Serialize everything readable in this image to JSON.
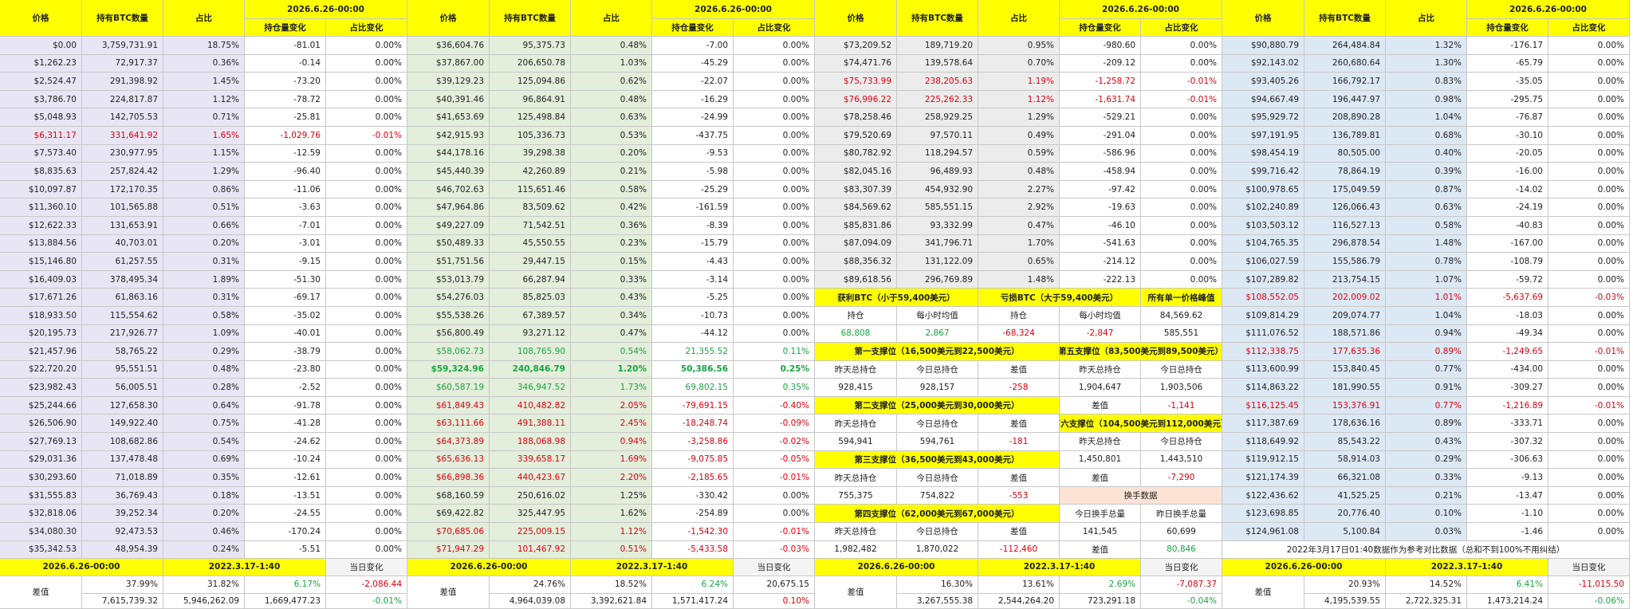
{
  "colors": {
    "block_bg": [
      "#e8e6f4",
      "#e3eedb",
      "#ececec",
      "#dde8f5"
    ],
    "header": "#ffff00",
    "red": "#e0000e",
    "green": "#1aa541",
    "swap": "#fbe3d6",
    "footer": "#f4f4f4"
  },
  "header": {
    "price": "价格",
    "btc": "持有BTC数量",
    "share": "占比",
    "date": "2026.6.26-00:00",
    "hold_change": "持仓量变化",
    "share_change": "占比变化"
  },
  "blocks": [
    {
      "rows": [
        [
          "$0.00",
          "3,759,731.91",
          "18.75%",
          "-81.01",
          "0.00%",
          ""
        ],
        [
          "$1,262.23",
          "72,917.37",
          "0.36%",
          "-0.14",
          "0.00%",
          ""
        ],
        [
          "$2,524.47",
          "291,398.92",
          "1.45%",
          "-73.20",
          "0.00%",
          ""
        ],
        [
          "$3,786.70",
          "224,817.87",
          "1.12%",
          "-78.72",
          "0.00%",
          ""
        ],
        [
          "$5,048.93",
          "142,705.53",
          "0.71%",
          "-25.81",
          "0.00%",
          ""
        ],
        [
          "$6,311.17",
          "331,641.92",
          "1.65%",
          "-1,029.76",
          "-0.01%",
          "red"
        ],
        [
          "$7,573.40",
          "230,977.95",
          "1.15%",
          "-12.59",
          "0.00%",
          ""
        ],
        [
          "$8,835.63",
          "257,824.42",
          "1.29%",
          "-96.40",
          "0.00%",
          ""
        ],
        [
          "$10,097.87",
          "172,170.35",
          "0.86%",
          "-11.06",
          "0.00%",
          ""
        ],
        [
          "$11,360.10",
          "101,565.88",
          "0.51%",
          "-3.63",
          "0.00%",
          ""
        ],
        [
          "$12,622.33",
          "131,653.91",
          "0.66%",
          "-7.01",
          "0.00%",
          ""
        ],
        [
          "$13,884.56",
          "40,703.01",
          "0.20%",
          "-3.01",
          "0.00%",
          ""
        ],
        [
          "$15,146.80",
          "61,257.55",
          "0.31%",
          "-9.15",
          "0.00%",
          ""
        ],
        [
          "$16,409.03",
          "378,495.34",
          "1.89%",
          "-51.30",
          "0.00%",
          ""
        ],
        [
          "$17,671.26",
          "61,863.16",
          "0.31%",
          "-69.17",
          "0.00%",
          ""
        ],
        [
          "$18,933.50",
          "115,554.62",
          "0.58%",
          "-35.02",
          "0.00%",
          ""
        ],
        [
          "$20,195.73",
          "217,926.77",
          "1.09%",
          "-40.01",
          "0.00%",
          ""
        ],
        [
          "$21,457.96",
          "58,765.22",
          "0.29%",
          "-38.79",
          "0.00%",
          ""
        ],
        [
          "$22,720.20",
          "95,551.51",
          "0.48%",
          "-23.80",
          "0.00%",
          ""
        ],
        [
          "$23,982.43",
          "56,005.51",
          "0.28%",
          "-2.52",
          "0.00%",
          ""
        ],
        [
          "$25,244.66",
          "127,658.30",
          "0.64%",
          "-91.78",
          "0.00%",
          ""
        ],
        [
          "$26,506.90",
          "149,922.40",
          "0.75%",
          "-41.28",
          "0.00%",
          ""
        ],
        [
          "$27,769.13",
          "108,682.86",
          "0.54%",
          "-24.62",
          "0.00%",
          ""
        ],
        [
          "$29,031.36",
          "137,478.48",
          "0.69%",
          "-10.24",
          "0.00%",
          ""
        ],
        [
          "$30,293.60",
          "71,018.89",
          "0.35%",
          "-12.61",
          "0.00%",
          ""
        ],
        [
          "$31,555.83",
          "36,769.43",
          "0.18%",
          "-13.51",
          "0.00%",
          ""
        ],
        [
          "$32,818.06",
          "39,252.34",
          "0.20%",
          "-24.55",
          "0.00%",
          ""
        ],
        [
          "$34,080.30",
          "92,473.53",
          "0.46%",
          "-170.24",
          "0.00%",
          ""
        ],
        [
          "$35,342.53",
          "48,954.39",
          "0.24%",
          "-5.51",
          "0.00%",
          ""
        ]
      ],
      "footer": {
        "diff_label": "差值",
        "d_a": "37.99%",
        "d_b": "31.82%",
        "d_c": "6.17%",
        "d_d": "-2,086.44",
        "t_a": "7,615,739.32",
        "t_b": "5,946,262.09",
        "t_c": "1,669,477.23",
        "t_d": "-0.01%"
      }
    },
    {
      "rows": [
        [
          "$36,604.76",
          "95,375.73",
          "0.48%",
          "-7.00",
          "0.00%",
          ""
        ],
        [
          "$37,867.00",
          "206,650.78",
          "1.03%",
          "-45.29",
          "0.00%",
          ""
        ],
        [
          "$39,129.23",
          "125,094.86",
          "0.62%",
          "-22.07",
          "0.00%",
          ""
        ],
        [
          "$40,391.46",
          "96,864.91",
          "0.48%",
          "-16.29",
          "0.00%",
          ""
        ],
        [
          "$41,653.69",
          "125,498.84",
          "0.63%",
          "-24.99",
          "0.00%",
          ""
        ],
        [
          "$42,915.93",
          "105,336.73",
          "0.53%",
          "-437.75",
          "0.00%",
          ""
        ],
        [
          "$44,178.16",
          "39,298.38",
          "0.20%",
          "-9.53",
          "0.00%",
          ""
        ],
        [
          "$45,440.39",
          "42,260.89",
          "0.21%",
          "-5.98",
          "0.00%",
          ""
        ],
        [
          "$46,702.63",
          "115,651.46",
          "0.58%",
          "-25.29",
          "0.00%",
          ""
        ],
        [
          "$47,964.86",
          "83,509.62",
          "0.42%",
          "-161.59",
          "0.00%",
          ""
        ],
        [
          "$49,227.09",
          "71,542.51",
          "0.36%",
          "-8.39",
          "0.00%",
          ""
        ],
        [
          "$50,489.33",
          "45,550.55",
          "0.23%",
          "-15.79",
          "0.00%",
          ""
        ],
        [
          "$51,751.56",
          "29,447.15",
          "0.15%",
          "-4.43",
          "0.00%",
          ""
        ],
        [
          "$53,013.79",
          "66,287.94",
          "0.33%",
          "-3.14",
          "0.00%",
          ""
        ],
        [
          "$54,276.03",
          "85,825.03",
          "0.43%",
          "-5.25",
          "0.00%",
          ""
        ],
        [
          "$55,538.26",
          "67,389.57",
          "0.34%",
          "-10.73",
          "0.00%",
          ""
        ],
        [
          "$56,800.49",
          "93,271.12",
          "0.47%",
          "-44.12",
          "0.00%",
          ""
        ],
        [
          "$58,062.73",
          "108,765.90",
          "0.54%",
          "21,355.52",
          "0.11%",
          "grn"
        ],
        [
          "$59,324.96",
          "240,846.79",
          "1.20%",
          "50,386.56",
          "0.25%",
          "grnb"
        ],
        [
          "$60,587.19",
          "346,947.52",
          "1.73%",
          "69,802.15",
          "0.35%",
          "grn"
        ],
        [
          "$61,849.43",
          "410,482.82",
          "2.05%",
          "-79,691.15",
          "-0.40%",
          "red"
        ],
        [
          "$63,111.66",
          "491,388.11",
          "2.45%",
          "-18,248.74",
          "-0.09%",
          "red"
        ],
        [
          "$64,373.89",
          "188,068.98",
          "0.94%",
          "-3,258.86",
          "-0.02%",
          "red"
        ],
        [
          "$65,636.13",
          "339,658.17",
          "1.69%",
          "-9,075.85",
          "-0.05%",
          "red"
        ],
        [
          "$66,898.36",
          "440,423.67",
          "2.20%",
          "-2,185.65",
          "-0.01%",
          "red"
        ],
        [
          "$68,160.59",
          "250,616.02",
          "1.25%",
          "-330.42",
          "0.00%",
          ""
        ],
        [
          "$69,422.82",
          "325,447.95",
          "1.62%",
          "-254.89",
          "0.00%",
          ""
        ],
        [
          "$70,685.06",
          "225,009.15",
          "1.12%",
          "-1,542.30",
          "-0.01%",
          "red"
        ],
        [
          "$71,947.29",
          "101,467.92",
          "0.51%",
          "-5,433.58",
          "-0.03%",
          "red"
        ]
      ],
      "footer": {
        "diff_label": "差值",
        "d_a": "24.76%",
        "d_b": "18.52%",
        "d_c": "6.24%",
        "d_d": "20,675.15",
        "t_a": "4,964,039.08",
        "t_b": "3,392,621.84",
        "t_c": "1,571,417.24",
        "t_d": "0.10%"
      }
    },
    {
      "rows": [
        [
          "$73,209.52",
          "189,719.20",
          "0.95%",
          "-980.60",
          "0.00%",
          ""
        ],
        [
          "$74,471.76",
          "139,578.64",
          "0.70%",
          "-209.12",
          "0.00%",
          ""
        ],
        [
          "$75,733.99",
          "238,205.63",
          "1.19%",
          "-1,258.72",
          "-0.01%",
          "red"
        ],
        [
          "$76,996.22",
          "225,262.33",
          "1.12%",
          "-1,631.74",
          "-0.01%",
          "red"
        ],
        [
          "$78,258.46",
          "258,929.25",
          "1.29%",
          "-529.21",
          "0.00%",
          ""
        ],
        [
          "$79,520.69",
          "97,570.11",
          "0.49%",
          "-291.04",
          "0.00%",
          ""
        ],
        [
          "$80,782.92",
          "118,294.57",
          "0.59%",
          "-586.96",
          "0.00%",
          ""
        ],
        [
          "$82,045.16",
          "96,489.93",
          "0.48%",
          "-458.94",
          "0.00%",
          ""
        ],
        [
          "$83,307.39",
          "454,932.90",
          "2.27%",
          "-97.42",
          "0.00%",
          ""
        ],
        [
          "$84,569.62",
          "585,551.15",
          "2.92%",
          "-19.63",
          "0.00%",
          ""
        ],
        [
          "$85,831.86",
          "93,332.99",
          "0.47%",
          "-46.10",
          "0.00%",
          ""
        ],
        [
          "$87,094.09",
          "341,796.71",
          "1.70%",
          "-541.63",
          "0.00%",
          ""
        ],
        [
          "$88,356.32",
          "131,122.09",
          "0.65%",
          "-214.12",
          "0.00%",
          ""
        ],
        [
          "$89,618.56",
          "296,769.89",
          "1.48%",
          "-222.13",
          "0.00%",
          ""
        ]
      ],
      "footer": {
        "diff_label": "差值",
        "d_a": "16.30%",
        "d_b": "13.61%",
        "d_c": "2.69%",
        "d_d": "-7,087.37",
        "t_a": "3,267,555.38",
        "t_b": "2,544,264.20",
        "t_c": "723,291.18",
        "t_d": "-0.04%"
      }
    },
    {
      "rows": [
        [
          "$90,880.79",
          "264,484.84",
          "1.32%",
          "-176.17",
          "0.00%",
          ""
        ],
        [
          "$92,143.02",
          "260,680.64",
          "1.30%",
          "-65.79",
          "0.00%",
          ""
        ],
        [
          "$93,405.26",
          "166,792.17",
          "0.83%",
          "-35.05",
          "0.00%",
          ""
        ],
        [
          "$94,667.49",
          "196,447.97",
          "0.98%",
          "-295.75",
          "0.00%",
          ""
        ],
        [
          "$95,929.72",
          "208,890.28",
          "1.04%",
          "-76.87",
          "0.00%",
          ""
        ],
        [
          "$97,191.95",
          "136,789.81",
          "0.68%",
          "-30.10",
          "0.00%",
          ""
        ],
        [
          "$98,454.19",
          "80,505.00",
          "0.40%",
          "-20.05",
          "0.00%",
          ""
        ],
        [
          "$99,716.42",
          "78,864.19",
          "0.39%",
          "-16.00",
          "0.00%",
          ""
        ],
        [
          "$100,978.65",
          "175,049.59",
          "0.87%",
          "-14.02",
          "0.00%",
          ""
        ],
        [
          "$102,240.89",
          "126,066.43",
          "0.63%",
          "-24.19",
          "0.00%",
          ""
        ],
        [
          "$103,503.12",
          "116,527.13",
          "0.58%",
          "-40.83",
          "0.00%",
          ""
        ],
        [
          "$104,765.35",
          "296,878.54",
          "1.48%",
          "-167.00",
          "0.00%",
          ""
        ],
        [
          "$106,027.59",
          "155,586.79",
          "0.78%",
          "-108.79",
          "0.00%",
          ""
        ],
        [
          "$107,289.82",
          "213,754.15",
          "1.07%",
          "-59.72",
          "0.00%",
          ""
        ],
        [
          "$108,552.05",
          "202,009.02",
          "1.01%",
          "-5,637.69",
          "-0.03%",
          "red"
        ],
        [
          "$109,814.29",
          "209,074.77",
          "1.04%",
          "-18.03",
          "0.00%",
          ""
        ],
        [
          "$111,076.52",
          "188,571.86",
          "0.94%",
          "-49.34",
          "0.00%",
          ""
        ],
        [
          "$112,338.75",
          "177,635.36",
          "0.89%",
          "-1,249.65",
          "-0.01%",
          "red"
        ],
        [
          "$113,600.99",
          "153,840.45",
          "0.77%",
          "-434.00",
          "0.00%",
          ""
        ],
        [
          "$114,863.22",
          "181,990.55",
          "0.91%",
          "-309.27",
          "0.00%",
          ""
        ],
        [
          "$116,125.45",
          "153,376.91",
          "0.77%",
          "-1,216.89",
          "-0.01%",
          "red"
        ],
        [
          "$117,387.69",
          "178,636.16",
          "0.89%",
          "-333.71",
          "0.00%",
          ""
        ],
        [
          "$118,649.92",
          "85,543.22",
          "0.43%",
          "-307.32",
          "0.00%",
          ""
        ],
        [
          "$119,912.15",
          "58,914.03",
          "0.29%",
          "-306.63",
          "0.00%",
          ""
        ],
        [
          "$121,174.39",
          "66,321.08",
          "0.33%",
          "-9.13",
          "0.00%",
          ""
        ],
        [
          "$122,436.62",
          "41,525.25",
          "0.21%",
          "-13.47",
          "0.00%",
          ""
        ],
        [
          "$123,698.85",
          "20,776.40",
          "0.10%",
          "-1.10",
          "0.00%",
          ""
        ],
        [
          "$124,961.08",
          "5,100.84",
          "0.03%",
          "-1.46",
          "0.00%",
          ""
        ]
      ],
      "footer": {
        "diff_label": "差值",
        "d_a": "20.93%",
        "d_b": "14.52%",
        "d_c": "6.41%",
        "d_d": "-11,015.50",
        "t_a": "4,195,539.55",
        "t_b": "2,722,325.31",
        "t_c": "1,473,214.24",
        "t_d": "-0.06%"
      }
    }
  ],
  "footer_header": {
    "date1": "2026.6.26-00:00",
    "date2": "2022.3.17-1:40",
    "change": "当日变化"
  },
  "block4_note": "2022年3月17日01:40数据作为参考对比数据（总和不到100%不用纠结）",
  "summary": {
    "profit": "获利BTC（小于59,400美元）",
    "loss": "亏损BTC（大于59,400美元）",
    "peak": "所有单一价格峰值",
    "hold": "持仓",
    "hourly": "每小时均值",
    "p_hold": "68,808",
    "p_hour": "2,867",
    "l_hold": "-68,324",
    "l_hour": "-2,847",
    "peak_val": "84,569.62",
    "peak_amt": "585,551",
    "s1": "第一支撑位（16,500美元到22,500美元）",
    "s5": "第五支撑位（83,500美元到89,500美元）",
    "yest": "昨天总持仓",
    "today": "今日总持仓",
    "diff": "差值",
    "s1_y": "928,415",
    "s1_t": "928,157",
    "s1_d": "-258",
    "s5_y": "1,904,647",
    "s5_t": "1,903,506",
    "s2": "第二支撑位（25,000美元到30,000美元）",
    "s5_d": "-1,141",
    "s2_y": "594,941",
    "s2_t": "594,761",
    "s2_d": "-181",
    "s6": "第六支撑位（104,500美元到112,000美元）",
    "s3": "第三支撑位（36,500美元到43,000美元）",
    "s6_y": "1,450,801",
    "s6_t": "1,443,510",
    "s3_y": "755,375",
    "s3_t": "754,822",
    "s3_d": "-553",
    "s6_d": "-7,290",
    "swap": "换手数据",
    "today_swap": "今日换手总量",
    "yest_swap": "昨日换手总量",
    "s4": "第四支撑位（62,000美元到67,000美元）",
    "swap_t": "141,545",
    "swap_y": "60,699",
    "s4_y": "1,982,482",
    "s4_t": "1,870,022",
    "s4_d": "-112,460",
    "swap_d": "80,846"
  }
}
